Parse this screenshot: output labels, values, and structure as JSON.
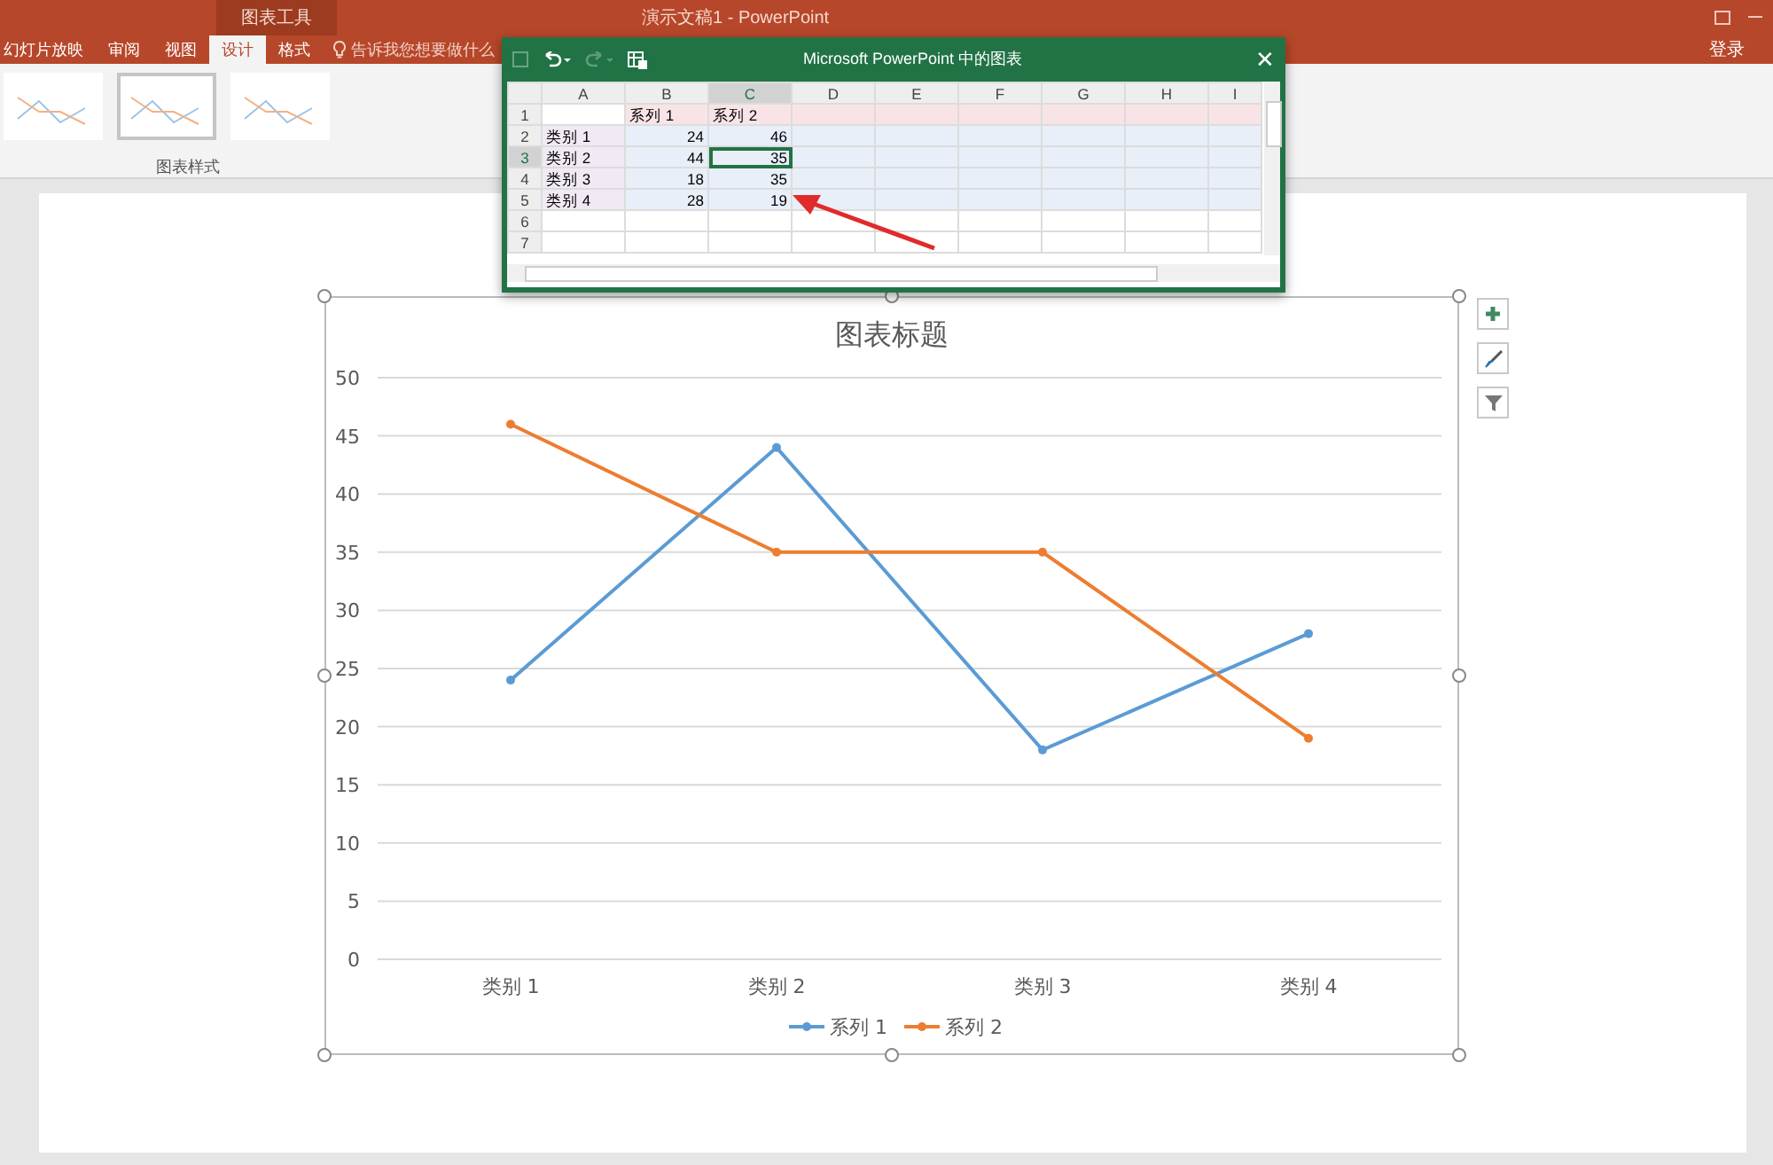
{
  "title_bar": {
    "context_group": "图表工具",
    "title": "演示文稿1 - PowerPoint"
  },
  "ribbon_tabs": [
    {
      "label": "幻灯片放映",
      "selected": false
    },
    {
      "label": "审阅",
      "selected": false
    },
    {
      "label": "视图",
      "selected": false
    },
    {
      "label": "设计",
      "selected": true
    },
    {
      "label": "格式",
      "selected": false
    }
  ],
  "tell_me": "告诉我您想要做什么",
  "sign_in": "登录",
  "chart_styles": {
    "label": "图表样式",
    "styles": [
      {
        "selected": false
      },
      {
        "selected": true
      },
      {
        "selected": false
      }
    ]
  },
  "data_window": {
    "title": "Microsoft PowerPoint 中的图表",
    "close": "✕",
    "columns": [
      {
        "label": "A",
        "selected": false
      },
      {
        "label": "B",
        "selected": false
      },
      {
        "label": "C",
        "selected": true
      },
      {
        "label": "D",
        "selected": false
      },
      {
        "label": "E",
        "selected": false
      },
      {
        "label": "F",
        "selected": false
      },
      {
        "label": "G",
        "selected": false
      },
      {
        "label": "H",
        "selected": false
      },
      {
        "label": "I",
        "selected": false
      }
    ],
    "rows": [
      {
        "number": "1",
        "selected": false,
        "cells": [
          "",
          "系列 1",
          "系列 2"
        ]
      },
      {
        "number": "2",
        "selected": false,
        "cells": [
          "类别 1",
          "24",
          "46"
        ]
      },
      {
        "number": "3",
        "selected": true,
        "cells": [
          "类别 2",
          "44",
          "35"
        ]
      },
      {
        "number": "4",
        "selected": false,
        "cells": [
          "类别 3",
          "18",
          "35"
        ]
      },
      {
        "number": "5",
        "selected": false,
        "cells": [
          "类别 4",
          "28",
          "19"
        ]
      },
      {
        "number": "6",
        "selected": false
      },
      {
        "number": "7",
        "selected": false
      }
    ]
  },
  "chart": {
    "chart_data": {
      "type": "line",
      "title": "图表标题",
      "categories": [
        "类别 1",
        "类别 2",
        "类别 3",
        "类别 4"
      ],
      "series": [
        {
          "name": "系列 1",
          "color": "#5b9bd5",
          "marker": "circle",
          "values": [
            24,
            44,
            18,
            28
          ]
        },
        {
          "name": "系列 2",
          "color": "#ed7d31",
          "marker": "circle",
          "values": [
            46,
            35,
            35,
            19
          ]
        }
      ],
      "grid": true,
      "legend": true,
      "ylim": [
        0,
        50
      ],
      "yticks": [
        0,
        5,
        10,
        15,
        20,
        25,
        30,
        35,
        40,
        45,
        50
      ]
    }
  }
}
